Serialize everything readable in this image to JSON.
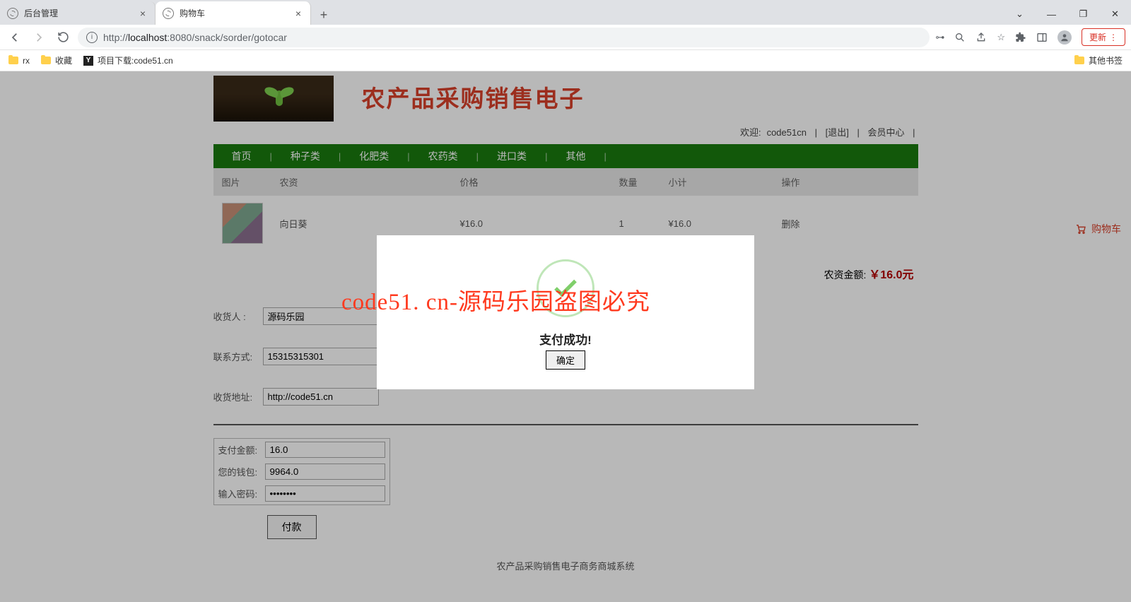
{
  "browser": {
    "tabs": [
      {
        "title": "后台管理"
      },
      {
        "title": "购物车"
      }
    ],
    "url_prefix": "http://",
    "url_host": "localhost",
    "url_rest": ":8080/snack/sorder/gotocar",
    "update": "更新",
    "bookmarks": [
      "rx",
      "收藏",
      "项目下载:code51.cn"
    ],
    "other_bm": "其他书签"
  },
  "site": {
    "title": "农产品采购销售电子",
    "welcome_label": "欢迎:",
    "username": "code51cn",
    "logout": "[退出]",
    "member_center": "会员中心",
    "sep": "|",
    "nav": [
      "首页",
      "种子类",
      "化肥类",
      "农药类",
      "进口类",
      "其他"
    ],
    "float_cart": "购物车"
  },
  "cart": {
    "headers": {
      "img": "图片",
      "name": "农资",
      "price": "价格",
      "qty": "数量",
      "subtotal": "小计",
      "op": "操作"
    },
    "row": {
      "name": "向日葵",
      "price": "¥16.0",
      "qty": "1",
      "subtotal": "¥16.0",
      "op": "删除"
    },
    "total_label": "农资金额:",
    "total_value": "￥16.0元"
  },
  "form": {
    "recipient_label": "收货人  :",
    "recipient_value": "源码乐园",
    "phone_label": "联系方式:",
    "phone_value": "15315315301",
    "addr_label": "收货地址:",
    "addr_value": "http://code51.cn",
    "amount_label": "支付金额:",
    "amount_value": "16.0",
    "wallet_label": "您的钱包:",
    "wallet_value": "9964.0",
    "pwd_label": "输入密码:",
    "pwd_value": "••••••••",
    "pay_btn": "付款"
  },
  "modal": {
    "msg": "支付成功!",
    "ok": "确定"
  },
  "watermark": "code51. cn-源码乐园盗图必究",
  "footer": "农产品采购销售电子商务商城系统"
}
